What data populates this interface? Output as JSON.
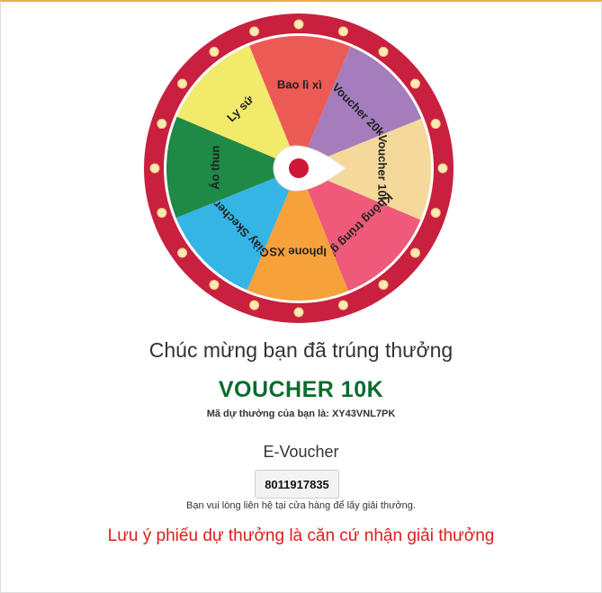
{
  "wheel": {
    "segments": [
      {
        "label": "Bao lì xì",
        "color": "#ec5a55"
      },
      {
        "label": "Voucher 20k",
        "color": "#a57cbc"
      },
      {
        "label": "Voucher 10k",
        "color": "#f5d99a"
      },
      {
        "label": "Không trúng giải",
        "color": "#f05a7a"
      },
      {
        "label": "Iphone XS",
        "color": "#f6a13a"
      },
      {
        "label": "Giày Skechers",
        "color": "#35b5e6"
      },
      {
        "label": "Áo thun",
        "color": "#1e8a45"
      },
      {
        "label": "Ly sứ",
        "color": "#f1ea6b"
      }
    ],
    "rim_color": "#c8203e",
    "bulb_color": "#fbe9b8",
    "pointer_icon": "pointer-arrow-icon",
    "pointer_dot_color": "#d0173a"
  },
  "result": {
    "congrats": "Chúc mừng bạn đã trúng thưởng",
    "prize": "VOUCHER 10K",
    "code_line": "Mã dự thưởng của bạn là: XY43VNL7PK"
  },
  "evoucher": {
    "title": "E-Voucher",
    "code": "8011917835",
    "contact_note": "Bạn vui lòng liên hệ tại cửa hàng để lấy giải thưởng."
  },
  "note": "Lưu ý phiếu dự thưởng là căn cứ nhận giải thưởng",
  "colors": {
    "prize": "#0b6b2f",
    "note": "#e01b1b",
    "frame_top": "#e8b04a"
  }
}
